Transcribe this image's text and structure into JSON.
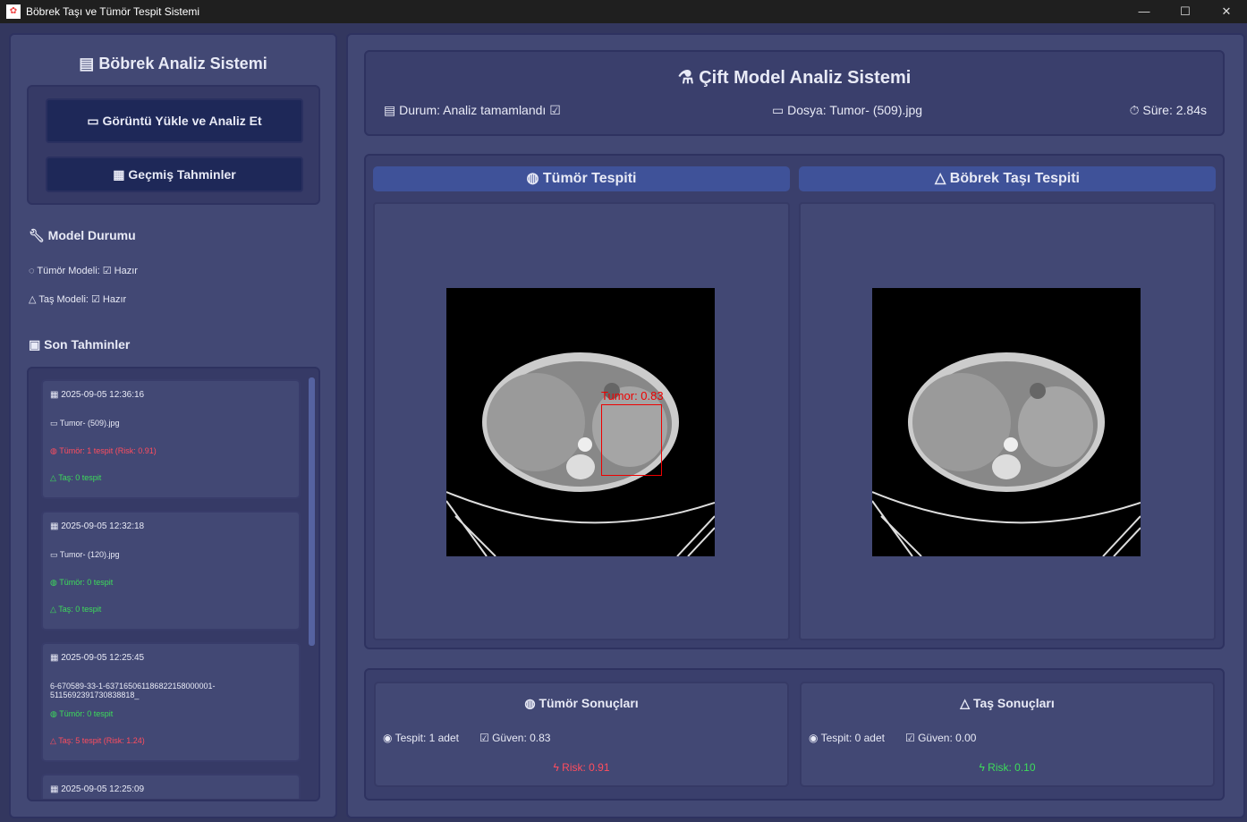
{
  "window": {
    "title": "Böbrek Taşı ve Tümör Tespit Sistemi",
    "minimize": "—",
    "maximize": "☐",
    "close": "✕"
  },
  "sidebar": {
    "title": "Böbrek Analiz Sistemi",
    "upload_button": "Görüntü Yükle ve Analiz Et",
    "history_button": "Geçmiş Tahminler",
    "model_status_title": "Model Durumu",
    "tumor_model": "Tümör Modeli: ☑ Hazır",
    "stone_model": "Taş Modeli: ☑ Hazır",
    "recent_title": "Son Tahminler",
    "recent": [
      {
        "time": "2025-09-05 12:36:16",
        "file": "Tumor- (509).jpg",
        "tumor": "Tümör: 1 tespit (Risk: 0.91)",
        "tumor_status": "risk",
        "stone": "Taş: 0 tespit",
        "stone_status": "ok"
      },
      {
        "time": "2025-09-05 12:32:18",
        "file": "Tumor- (120).jpg",
        "tumor": "Tümör: 0 tespit",
        "tumor_status": "ok",
        "stone": "Taş: 0 tespit",
        "stone_status": "ok"
      },
      {
        "time": "2025-09-05 12:25:45",
        "file": "6-670589-33-1-637165061186822158000001-5115692391730838818_",
        "tumor": "Tümör: 0 tespit",
        "tumor_status": "ok",
        "stone": "Taş: 5 tespit (Risk: 1.24)",
        "stone_status": "risk"
      },
      {
        "time": "2025-09-05 12:25:09"
      }
    ]
  },
  "header": {
    "title": "Çift Model Analiz Sistemi",
    "status": "Durum: Analiz tamamlandı ☑",
    "file": "Dosya: Tumor- (509).jpg",
    "duration": "Süre: 2.84s"
  },
  "panels": {
    "tumor_title": "Tümör Tespiti",
    "stone_title": "Böbrek Taşı Tespiti",
    "tumor_box_label": "Tumor: 0.83"
  },
  "results": {
    "tumor": {
      "title": "Tümör Sonuçları",
      "count": "Tespit: 1 adet",
      "confidence": "Güven: 0.83",
      "risk": "Risk: 0.91"
    },
    "stone": {
      "title": "Taş Sonuçları",
      "count": "Tespit: 0 adet",
      "confidence": "Güven: 0.00",
      "risk": "Risk: 0.10"
    }
  },
  "colors": {
    "risk": "#ff4d5e",
    "ok": "#3ddc5a",
    "button": "#1e2858",
    "panel": "#424874"
  }
}
